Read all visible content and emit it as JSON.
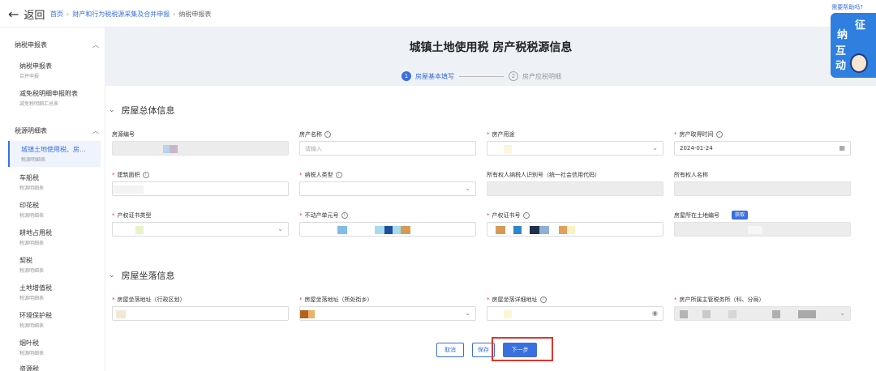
{
  "topbar": {
    "back_label": "返回",
    "breadcrumb": [
      "首页",
      "财产和行为税税源采集及合并申报",
      "纳税申报表"
    ],
    "help_link": "需要帮助吗?"
  },
  "sidebar": {
    "groups": [
      {
        "label": "纳税申报表",
        "items": [
          {
            "label": "纳税申报表",
            "sub": "合并申报"
          },
          {
            "label": "减免税明细申报附表",
            "sub": "减免税明细汇总表"
          }
        ]
      },
      {
        "label": "税源明细表",
        "items": [
          {
            "label": "城镇土地使用税、房...",
            "sub": "税源明细表"
          },
          {
            "label": "车船税",
            "sub": "税源明细表"
          },
          {
            "label": "印花税",
            "sub": "税源明细表"
          },
          {
            "label": "耕地占用税",
            "sub": "税源明细表"
          },
          {
            "label": "契税",
            "sub": "税源明细表"
          },
          {
            "label": "土地增值税",
            "sub": "税源明细表"
          },
          {
            "label": "环境保护税",
            "sub": "税源明细表"
          },
          {
            "label": "烟叶税",
            "sub": "税源明细表"
          },
          {
            "label": "资源税",
            "sub": ""
          }
        ]
      }
    ]
  },
  "main": {
    "title": "城镇土地使用税 房产税税源信息",
    "steps": [
      {
        "num": "1",
        "label": "房屋基本填写"
      },
      {
        "num": "2",
        "label": "房产应税明细"
      }
    ],
    "section1": {
      "title": "房屋总体信息",
      "row1": {
        "f1": "房源编号",
        "f2": "房产名称",
        "f2_placeholder": "请输入",
        "f3": "房产用途",
        "f4": "房产取得时间",
        "f4_value": "2024-01-24"
      },
      "row2": {
        "f1": "建筑面积",
        "f2": "纳税人类型",
        "f3": "所有权人纳税人识别号（统一社会信用代码）",
        "f4": "所有权人名称"
      },
      "row3": {
        "f1": "产权证书类型",
        "f2": "不动产单元号",
        "f3": "产权证书号",
        "f4": "房屋所在土地编号",
        "get_button": "获取"
      }
    },
    "section2": {
      "title": "房屋坐落信息",
      "row1": {
        "f1": "房屋坐落地址（行政区划）",
        "f2": "房屋坐落地址（所处街乡）",
        "f3": "房屋坐落详细地址",
        "f4": "房产所属主管税务所（科、分局）"
      }
    },
    "buttons": {
      "cancel": "取消",
      "save": "保存",
      "next": "下一步"
    }
  },
  "mascot": {
    "chars": [
      "征",
      "纳",
      "互",
      "动"
    ]
  },
  "colors": {
    "primary": "#3a6fe0",
    "required": "#e53935",
    "highlight": "#e0352b"
  }
}
